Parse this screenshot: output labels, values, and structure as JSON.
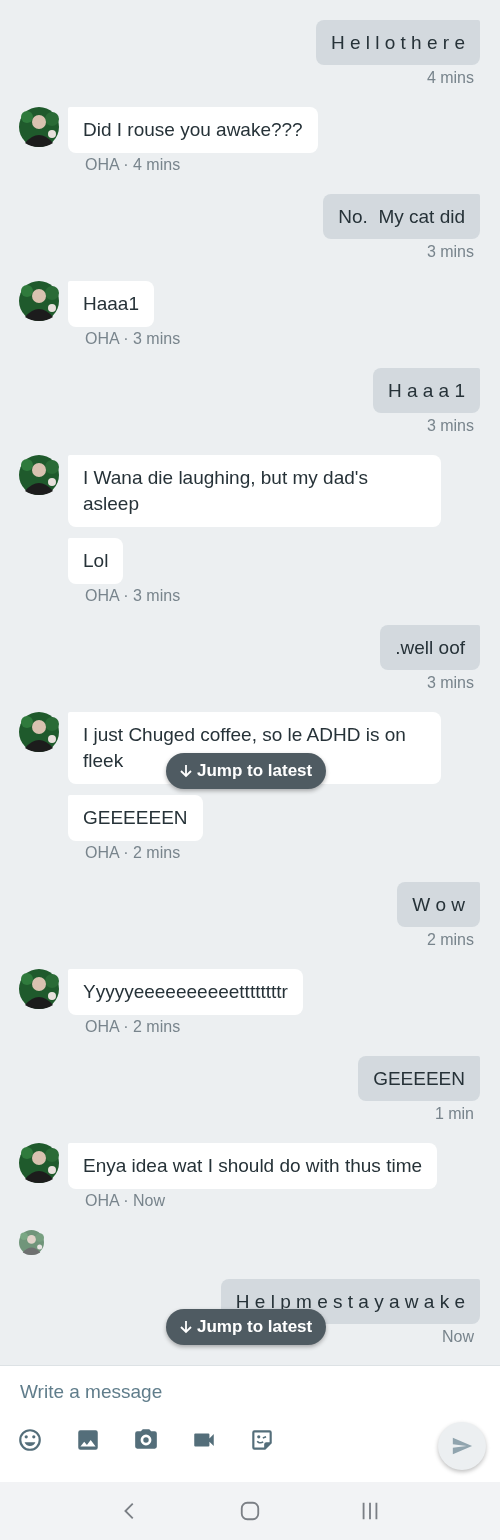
{
  "messages": [
    {
      "kind": "sent",
      "text": "H e l l o t h e r e",
      "time": "4 mins"
    },
    {
      "kind": "received",
      "bubbles": [
        "Did I rouse you awake???"
      ],
      "meta": "OHA · 4 mins"
    },
    {
      "kind": "sent",
      "text": "No.  My cat did",
      "time": "3 mins"
    },
    {
      "kind": "received",
      "bubbles": [
        "Haaa1"
      ],
      "meta": "OHA · 3 mins"
    },
    {
      "kind": "sent",
      "text": "H a a a 1",
      "time": "3 mins"
    },
    {
      "kind": "received",
      "bubbles": [
        "I Wana die laughing, but my dad's asleep",
        "Lol"
      ],
      "meta": "OHA · 3 mins"
    },
    {
      "kind": "sent",
      "text": ".well oof",
      "time": "3 mins"
    },
    {
      "kind": "received",
      "bubbles": [
        "I just Chuged coffee, so le ADHD is on fleek",
        "GEEEEEEN"
      ],
      "meta": "OHA · 2 mins",
      "jump_label": "Jump to latest"
    },
    {
      "kind": "sent",
      "text": "W o w",
      "time": "2 mins"
    },
    {
      "kind": "received",
      "bubbles": [
        "Yyyyyeeeeeeeeeettttttttr"
      ],
      "meta": "OHA · 2 mins"
    },
    {
      "kind": "sent",
      "text": "GEEEEEN",
      "time": "1 min"
    },
    {
      "kind": "received",
      "bubbles": [
        "Enya idea wat I should do with thus time"
      ],
      "meta": "OHA · Now"
    },
    {
      "kind": "seen"
    },
    {
      "kind": "sent",
      "text": "H e l p m e s t a y a w a k e",
      "time": "Now",
      "jump_label": "Jump to latest"
    }
  ],
  "composer": {
    "placeholder": "Write a message"
  }
}
